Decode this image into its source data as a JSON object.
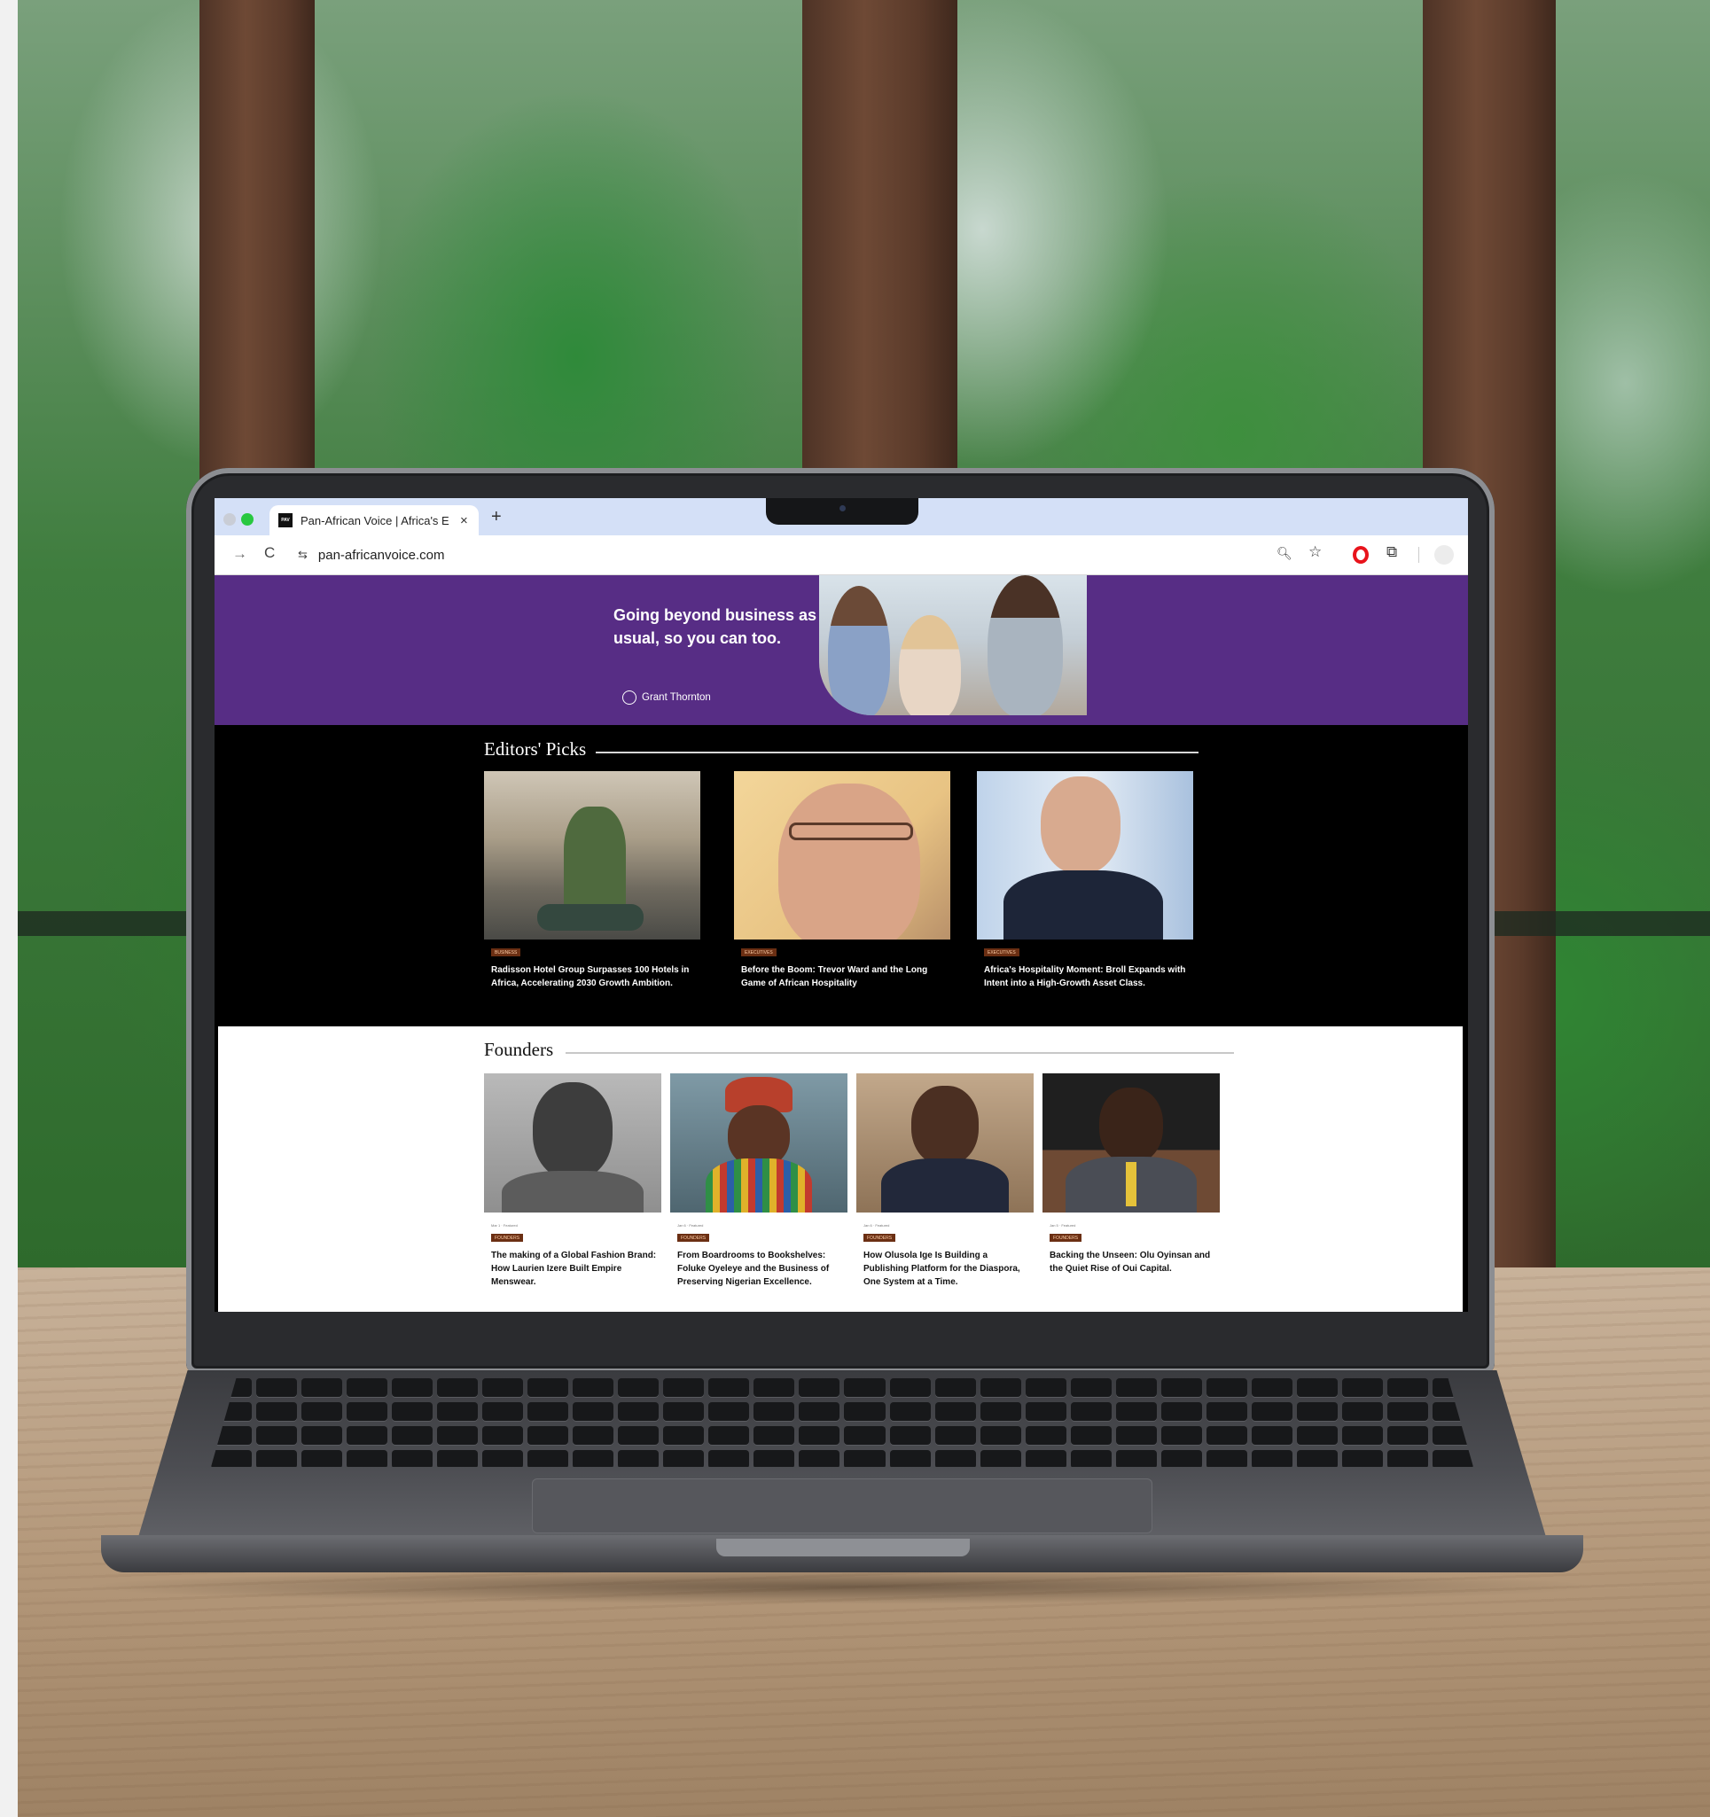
{
  "browser": {
    "tab_favicon": "PAV",
    "tab_title": "Pan-African Voice | Africa's E",
    "tab_close": "×",
    "new_tab": "+",
    "forward": "→",
    "reload": "C",
    "site_info": "⇆",
    "url": "pan-africanvoice.com",
    "toolbar_icons": [
      "zoom-icon",
      "star-icon",
      "opera-icon",
      "extensions-icon",
      "profile-avatar"
    ]
  },
  "ad": {
    "headline": "Going beyond business as usual, so you can too.",
    "brand": "Grant Thornton"
  },
  "editors_picks": {
    "title": "Editors' Picks",
    "cards": [
      {
        "tag": "BUSINESS",
        "headline": "Radisson Hotel Group Surpasses 100 Hotels in Africa, Accelerating 2030 Growth Ambition."
      },
      {
        "tag": "EXECUTIVES",
        "headline": "Before the Boom: Trevor Ward and the Long Game of African Hospitality"
      },
      {
        "tag": "EXECUTIVES",
        "headline": "Africa's Hospitality Moment: Broll Expands with Intent into a High-Growth Asset Class."
      }
    ]
  },
  "founders": {
    "title": "Founders",
    "cards": [
      {
        "meta": "Mar 1 · Featured",
        "tag": "FOUNDERS",
        "headline": "The making of a Global Fashion Brand: How Laurien Izere Built Empire Menswear."
      },
      {
        "meta": "Jan 6 · Featured",
        "tag": "FOUNDERS",
        "headline": "From Boardrooms to Bookshelves: Foluke Oyeleye and the Business of Preserving Nigerian Excellence."
      },
      {
        "meta": "Jan 6 · Featured",
        "tag": "FOUNDERS",
        "headline": "How Olusola Ige Is Building a Publishing Platform for the Diaspora, One System at a Time."
      },
      {
        "meta": "Jan 5 · Featured",
        "tag": "FOUNDERS",
        "headline": "Backing the Unseen: Olu Oyinsan and the Quiet Rise of Oui Capital."
      }
    ]
  },
  "colors": {
    "ad_purple": "#572d85",
    "tag_brown": "#6b2f13",
    "opera_red": "#e8131b"
  }
}
